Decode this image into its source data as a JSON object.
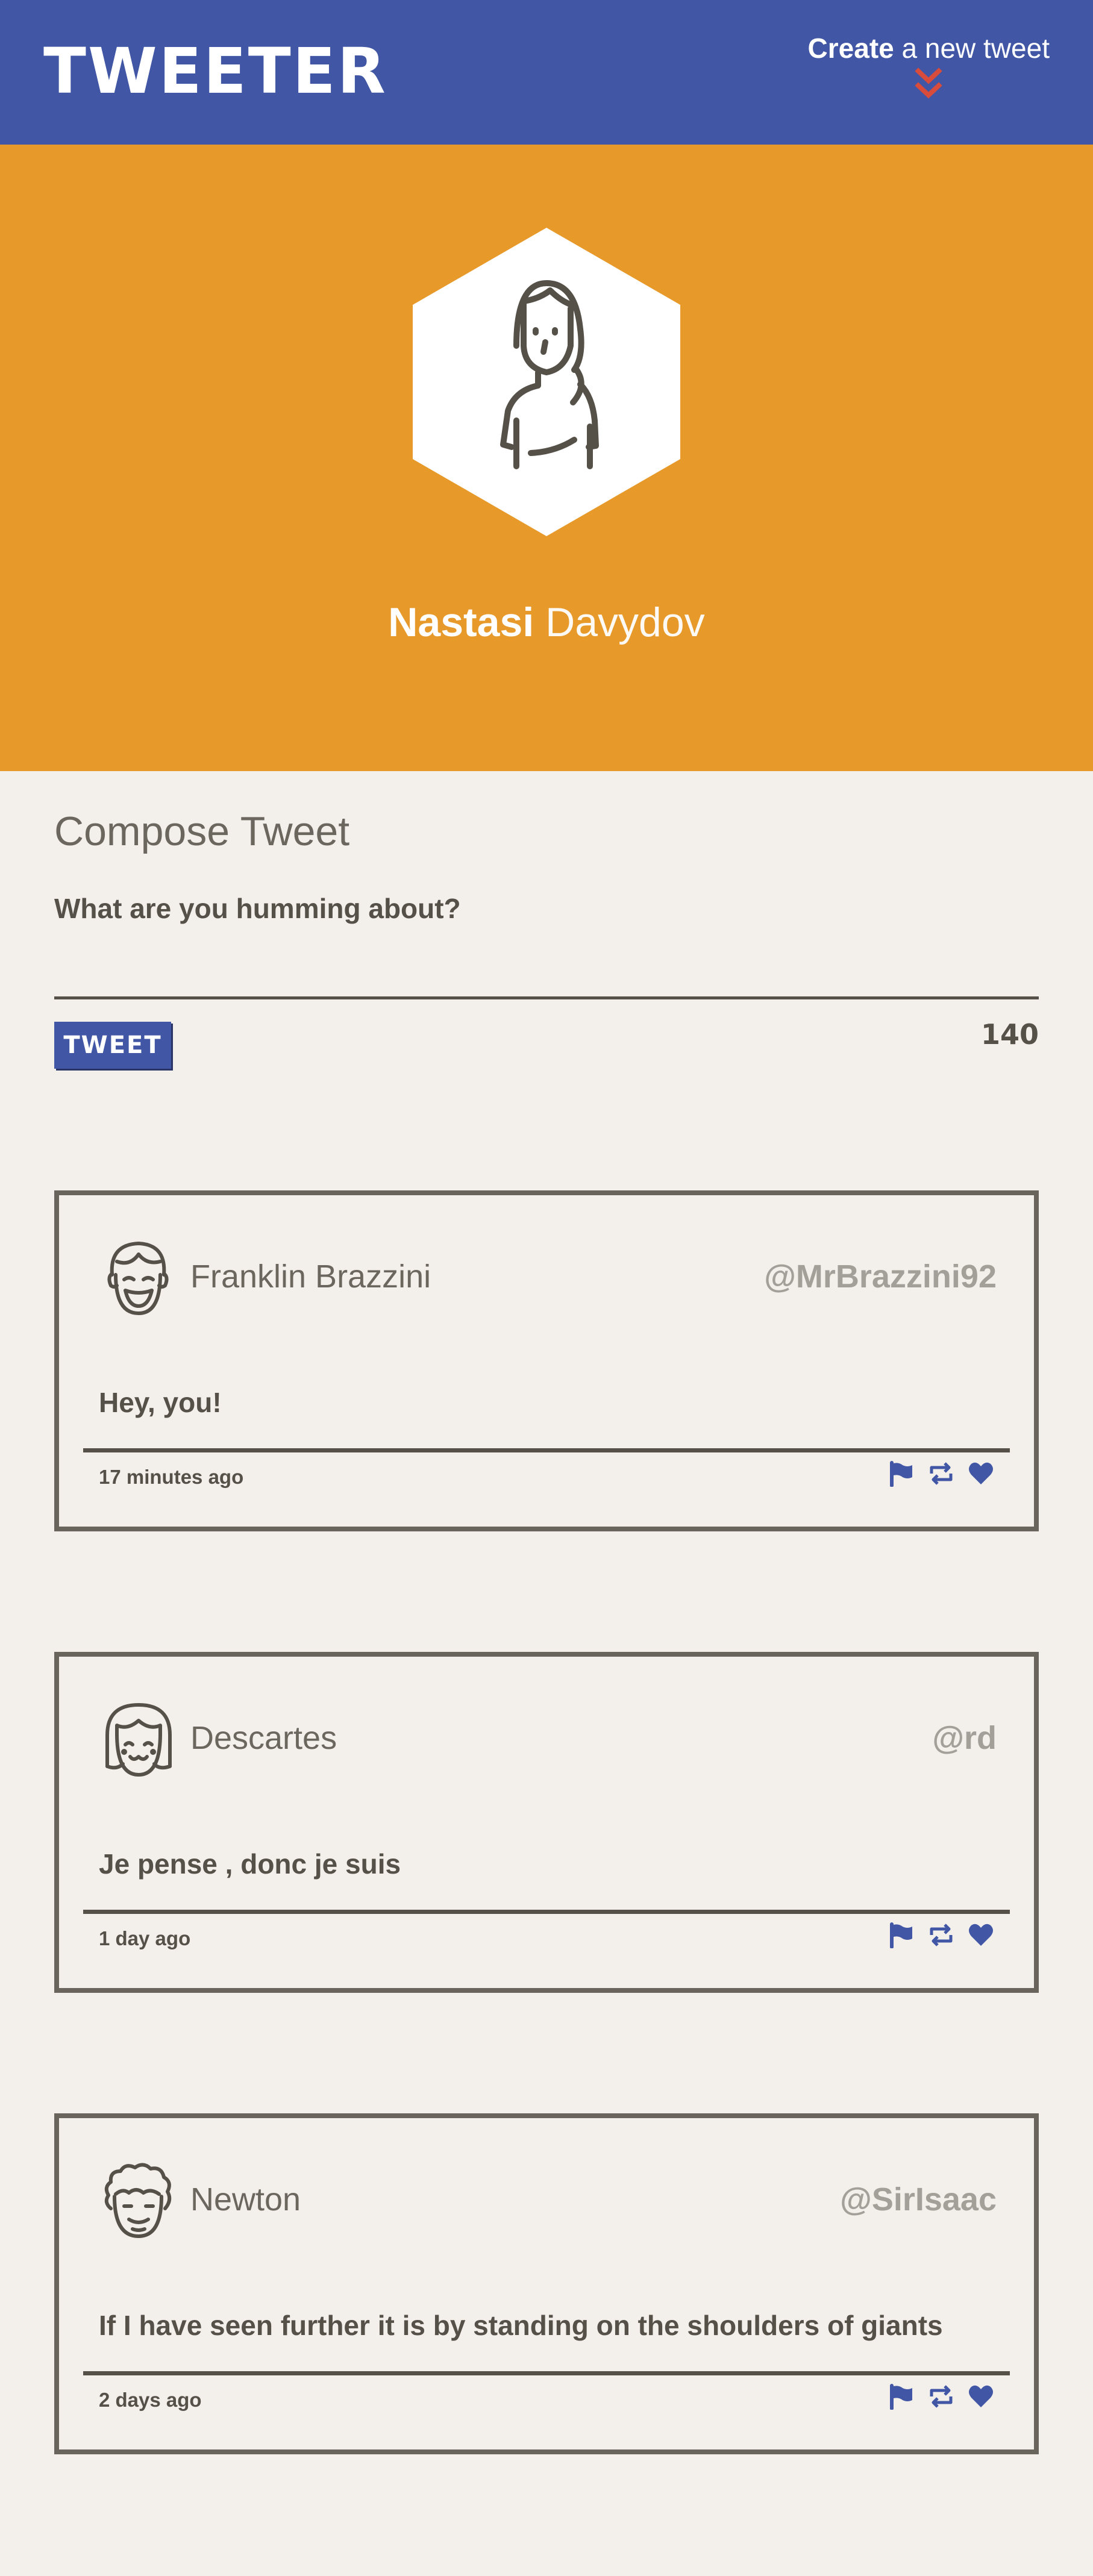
{
  "nav": {
    "logo": "TWEETER",
    "compose_bold": "Create",
    "compose_rest": " a new tweet"
  },
  "profile": {
    "first_name": "Nastasi",
    "last_name": "Davydov"
  },
  "compose": {
    "title": "Compose Tweet",
    "placeholder": "What are you humming about?",
    "button_label": "TWEET",
    "counter": "140"
  },
  "tweets": [
    {
      "name": "Franklin Brazzini",
      "handle": "@MrBrazzini92",
      "text": "Hey, you!",
      "time": "17 minutes ago",
      "avatar": "boy-face-icon"
    },
    {
      "name": "Descartes",
      "handle": "@rd",
      "text": "Je pense , donc je suis",
      "time": "1 day ago",
      "avatar": "bob-hair-face-icon"
    },
    {
      "name": "Newton",
      "handle": "@SirIsaac",
      "text": "If I have seen further it is by standing on the shoulders of giants",
      "time": "2 days ago",
      "avatar": "curly-hair-face-icon"
    }
  ],
  "colors": {
    "nav_bg": "#4156a4",
    "header_bg": "#e79a29",
    "page_bg": "#f3f0ec",
    "text_dark": "#555149",
    "accent_red": "#d94b3a",
    "action_blue": "#4156a4"
  }
}
